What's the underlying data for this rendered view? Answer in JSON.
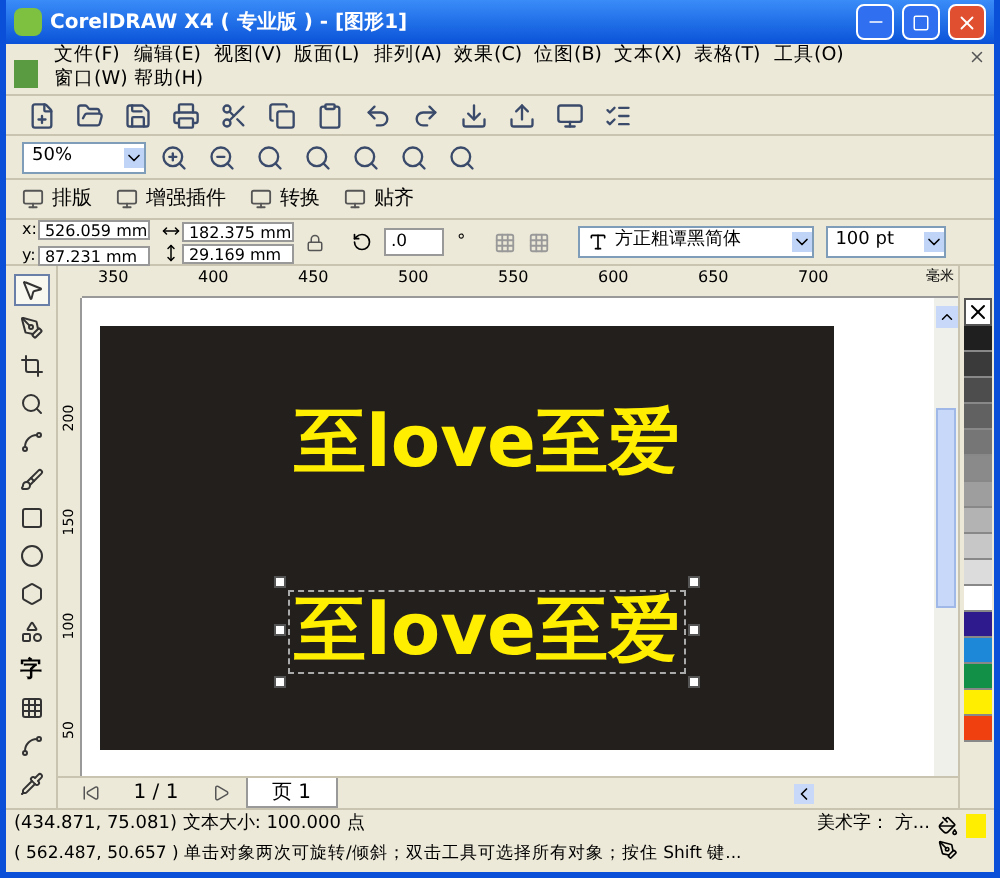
{
  "window": {
    "title": "CorelDRAW X4 ( 专业版 ) - [图形1]"
  },
  "menu": [
    {
      "label": "文件(F)"
    },
    {
      "label": "编辑(E)"
    },
    {
      "label": "视图(V)"
    },
    {
      "label": "版面(L)"
    },
    {
      "label": "排列(A)"
    },
    {
      "label": "效果(C)"
    },
    {
      "label": "位图(B)"
    },
    {
      "label": "文本(X)"
    },
    {
      "label": "表格(T)"
    },
    {
      "label": "工具(O)"
    },
    {
      "label": "窗口(W)"
    },
    {
      "label": "帮助(H)"
    }
  ],
  "zoom": {
    "value": "50%"
  },
  "plugin_bar": [
    {
      "label": "排版"
    },
    {
      "label": "增强插件"
    },
    {
      "label": "转换"
    },
    {
      "label": "贴齐"
    }
  ],
  "property_bar": {
    "x_label": "x:",
    "y_label": "y:",
    "x": "526.059 mm",
    "y": "87.231 mm",
    "width": "182.375 mm",
    "height": "29.169 mm",
    "rotation": ".0",
    "degree": "°",
    "font": "方正粗谭黑简体",
    "size": "100 pt"
  },
  "ruler": {
    "h_labels": [
      "350",
      "400",
      "450",
      "500",
      "550",
      "600",
      "650",
      "700"
    ],
    "unit": "毫米",
    "v_labels": [
      "200",
      "150",
      "100",
      "50"
    ]
  },
  "toolbox": [
    {
      "selected": true
    },
    {
      "selected": false
    },
    {
      "selected": false
    },
    {
      "selected": false
    },
    {
      "selected": false
    },
    {
      "selected": false
    },
    {
      "selected": false
    },
    {
      "selected": false
    },
    {
      "selected": false
    },
    {
      "selected": false
    },
    {
      "selected": false,
      "label": "字"
    },
    {
      "selected": false
    },
    {
      "selected": false
    },
    {
      "selected": false
    }
  ],
  "artwork": [
    {
      "text": "至love至爱",
      "selected": false
    },
    {
      "text": "至love至爱",
      "selected": true
    }
  ],
  "palette": [
    {
      "color": "#1f1f1f"
    },
    {
      "color": "#3a3a3a"
    },
    {
      "color": "#4d4d4d"
    },
    {
      "color": "#616161"
    },
    {
      "color": "#767676"
    },
    {
      "color": "#8a8a8a"
    },
    {
      "color": "#9e9e9e"
    },
    {
      "color": "#b3b3b3"
    },
    {
      "color": "#c7c7c7"
    },
    {
      "color": "#dcdcdc"
    },
    {
      "color": "#ffffff"
    },
    {
      "color": "#2e1a8c"
    },
    {
      "color": "#1e88d8"
    },
    {
      "color": "#139048"
    },
    {
      "color": "#ffee00"
    },
    {
      "color": "#f04010"
    }
  ],
  "page_nav": {
    "count": "1 / 1",
    "tabs": [
      {
        "label": "页 1",
        "selected": true
      }
    ]
  },
  "status_bar": {
    "line1": "(434.871, 75.081) 文本大小: 100.000 点",
    "line2": "( 562.487, 50.657 )    单击对象两次可旋转/倾斜；双击工具可选择所有对象；按住 Shift 键...",
    "object": "美术字： 方..."
  }
}
